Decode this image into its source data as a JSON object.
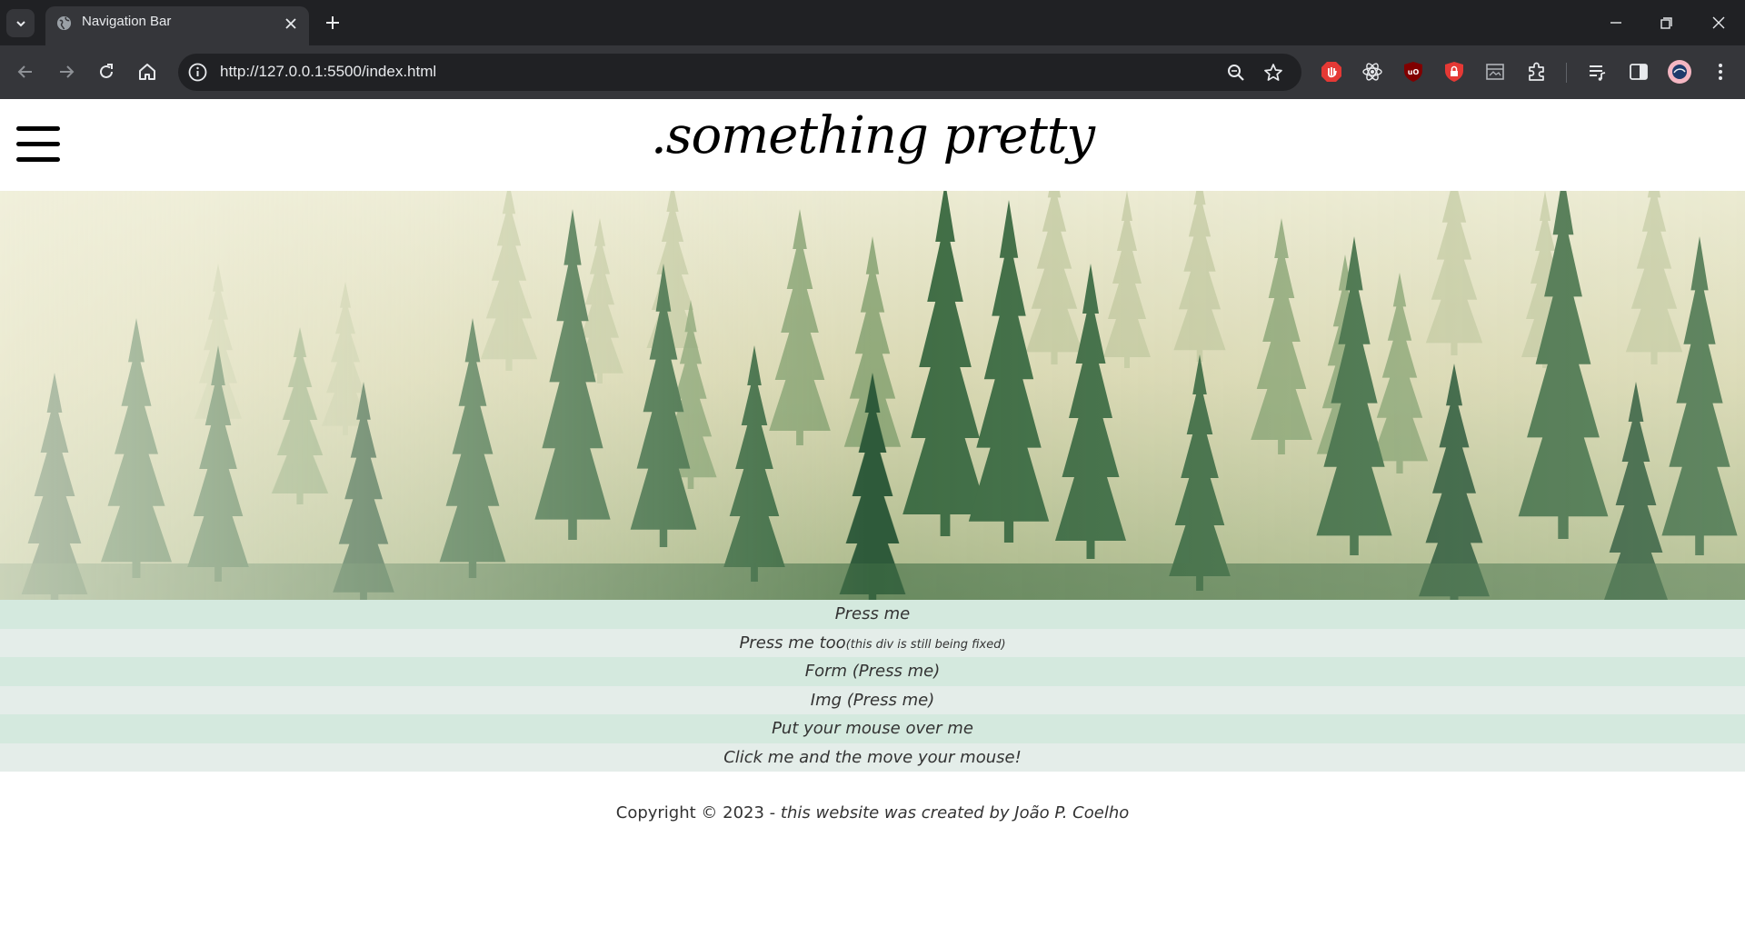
{
  "browser": {
    "tab_title": "Navigation Bar",
    "url": "http://127.0.0.1:5500/index.html",
    "colors": {
      "titlebar": "#202124",
      "toolbar": "#35363a",
      "text": "#e8eaed"
    },
    "extensions": [
      "adblock-icon",
      "react-devtools-icon",
      "ublock-icon",
      "lock-extension-icon",
      "media-extension-icon",
      "puzzle-icon"
    ]
  },
  "site": {
    "title": ".something pretty",
    "menu_items": [
      {
        "label": "Press me",
        "note": ""
      },
      {
        "label": "Press me too",
        "note": "(this div is still being fixed)"
      },
      {
        "label": "Form (Press me)",
        "note": ""
      },
      {
        "label": "Img (Press me)",
        "note": ""
      },
      {
        "label": "Put your mouse over me",
        "note": ""
      },
      {
        "label": "Click me and the move your mouse!",
        "note": ""
      }
    ],
    "footer": {
      "copyright": "Copyright © 2023 - ",
      "credit": "this website was created by João P. Coelho"
    },
    "colors": {
      "row_odd": "#d4e9de",
      "row_even": "#e4ede9"
    }
  }
}
